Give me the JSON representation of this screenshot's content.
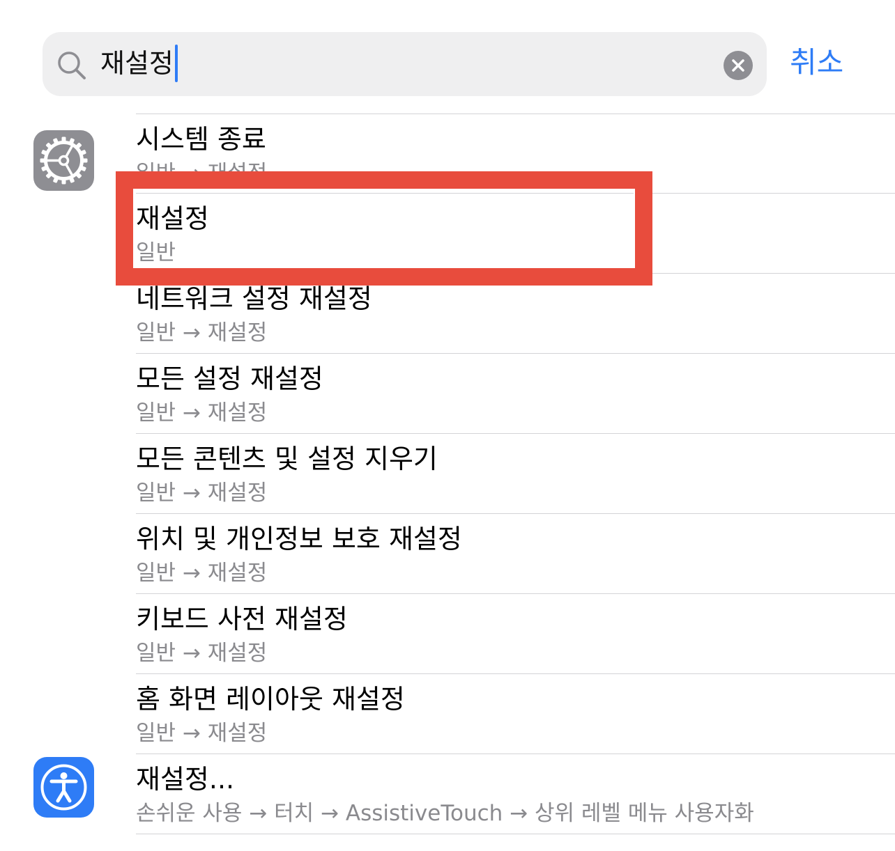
{
  "search": {
    "query": "재설정",
    "cancel_label": "취소"
  },
  "results": [
    {
      "title": "시스템 종료",
      "path": "일반 → 재설정",
      "app": "settings"
    },
    {
      "title": "재설정",
      "path": "일반",
      "app": "settings",
      "highlighted": true
    },
    {
      "title": "네트워크 설정 재설정",
      "path": "일반 → 재설정",
      "app": "settings"
    },
    {
      "title": "모든 설정 재설정",
      "path": "일반 → 재설정",
      "app": "settings"
    },
    {
      "title": "모든 콘텐츠 및 설정 지우기",
      "path": "일반 → 재설정",
      "app": "settings"
    },
    {
      "title": "위치 및 개인정보 보호 재설정",
      "path": "일반 → 재설정",
      "app": "settings"
    },
    {
      "title": "키보드 사전 재설정",
      "path": "일반 → 재설정",
      "app": "settings"
    },
    {
      "title": "홈 화면 레이아웃 재설정",
      "path": "일반 → 재설정",
      "app": "settings"
    },
    {
      "title": "재설정...",
      "path": "손쉬운 사용 → 터치 → AssistiveTouch → 상위 레벨 메뉴 사용자화",
      "app": "accessibility"
    }
  ],
  "icons": {
    "settings_app": "gear-icon",
    "accessibility_app": "accessibility-icon",
    "search": "search-icon",
    "clear": "clear-icon"
  },
  "colors": {
    "accent": "#2e7cf6",
    "highlight": "#e84c3d",
    "secondary_text": "#8a8a8e",
    "search_bg": "#efeff0"
  }
}
